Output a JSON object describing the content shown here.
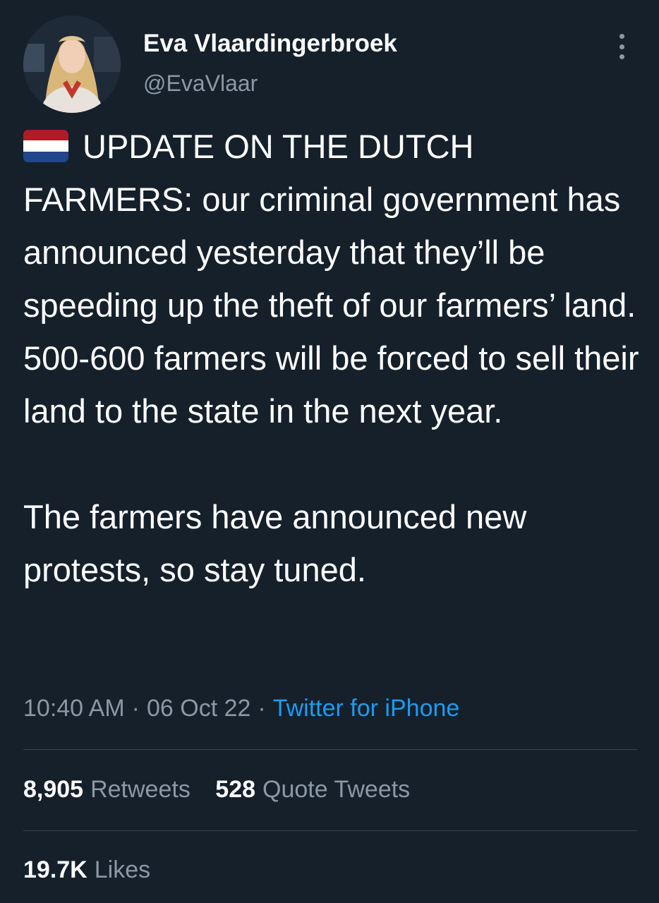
{
  "user": {
    "display_name": "Eva Vlaardingerbroek",
    "handle": "@EvaVlaar"
  },
  "tweet": {
    "flag_icon": "netherlands-flag-emoji",
    "paragraph_1": "UPDATE ON THE DUTCH FARMERS: our criminal government has announced yesterday that they’ll be speeding up the theft of our farmers’ land. 500-600 farmers will be forced to sell their land to the state in the next year.",
    "paragraph_2": "The farmers have announced new protests, so stay tuned."
  },
  "meta": {
    "time": "10:40 AM",
    "separator": "·",
    "date": "06 Oct 22",
    "source": "Twitter for iPhone"
  },
  "stats": {
    "retweets_count": "8,905",
    "retweets_label": "Retweets",
    "quotes_count": "528",
    "quotes_label": "Quote Tweets",
    "likes_count": "19.7K",
    "likes_label": "Likes"
  },
  "colors": {
    "background": "#15202b",
    "text": "#ffffff",
    "secondary_text": "#8b98a5",
    "link": "#1d9bf0",
    "divider": "#38444d",
    "flag_red": "#ae1c28",
    "flag_white": "#ffffff",
    "flag_blue": "#21468b"
  }
}
